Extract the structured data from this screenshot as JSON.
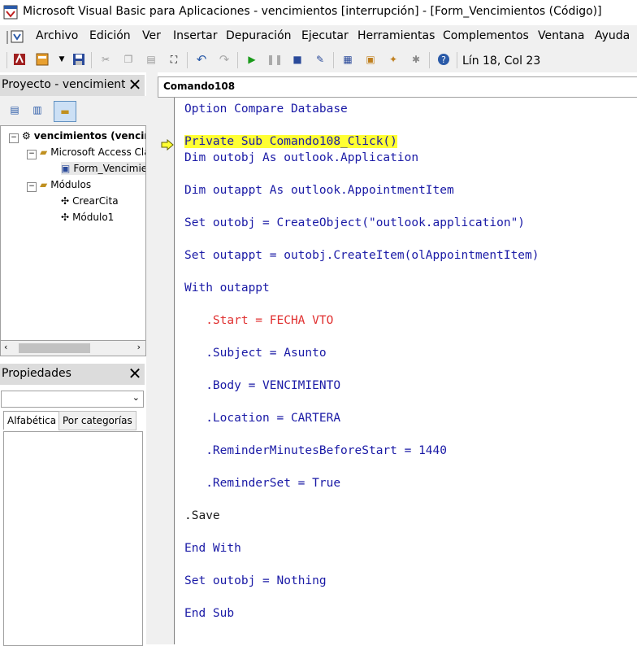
{
  "window": {
    "title": "Microsoft Visual Basic para Aplicaciones - vencimientos [interrupción] - [Form_Vencimientos (Código)]"
  },
  "menu": [
    {
      "label": "Archivo"
    },
    {
      "label": "Edición"
    },
    {
      "label": "Ver"
    },
    {
      "label": "Insertar"
    },
    {
      "label": "Depuración"
    },
    {
      "label": "Ejecutar"
    },
    {
      "label": "Herramientas"
    },
    {
      "label": "Complementos"
    },
    {
      "label": "Ventana"
    },
    {
      "label": "Ayuda"
    }
  ],
  "toolbar": {
    "status": "Lín 18, Col 23"
  },
  "project": {
    "title": "Proyecto - vencimientos",
    "tree": [
      {
        "label": "vencimientos (vencimientos)"
      },
      {
        "label": "Microsoft Access Class Objects"
      },
      {
        "label": "Form_Vencimientos"
      },
      {
        "label": "Módulos"
      },
      {
        "label": "CrearCita"
      },
      {
        "label": "Módulo1"
      }
    ]
  },
  "properties": {
    "title": "Propiedades",
    "tab_alpha": "Alfabética",
    "tab_cat": "Por categorías"
  },
  "code": {
    "object_box": "Comando108",
    "lines": {
      "l1": "Option Compare Database",
      "l2": "Private Sub Comando108_Click()",
      "l3": "Dim outobj As outlook.Application",
      "l4": "Dim outappt As outlook.AppointmentItem",
      "l5": "Set outobj = CreateObject(\"outlook.application\")",
      "l6": "Set outappt = outobj.CreateItem(olAppointmentItem)",
      "l7": "With outappt",
      "l8": "   .Start = FECHA VTO",
      "l9": "   .Subject = Asunto",
      "l10": "   .Body = VENCIMIENTO",
      "l11": "   .Location = CARTERA",
      "l12": "   .ReminderMinutesBeforeStart = 1440",
      "l13a": "   .ReminderSet = ",
      "l13b": "True",
      "l14": ".Save",
      "l15": "End With",
      "l16a": "Set outobj = ",
      "l16b": "Nothing",
      "l17": "End Sub"
    }
  },
  "colors": {
    "keyword": "#1a1aa6",
    "error": "#e03030",
    "highlight": "#ffff33"
  }
}
